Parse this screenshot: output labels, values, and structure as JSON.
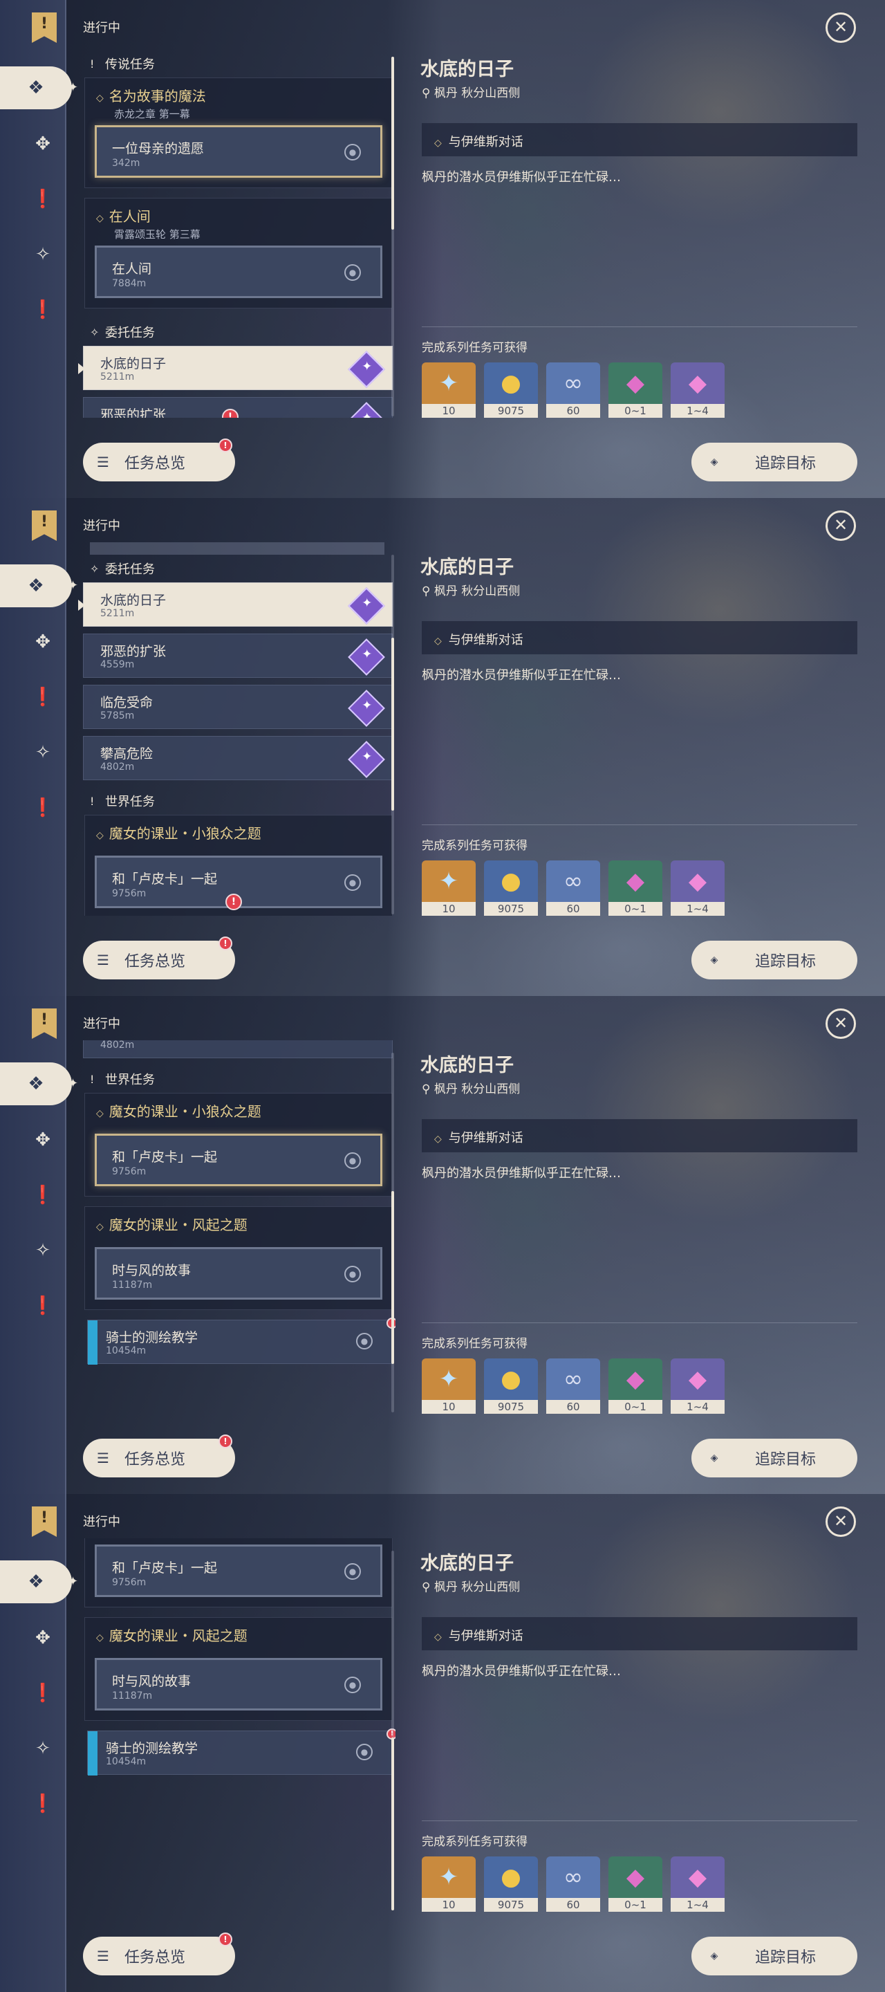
{
  "header": {
    "label": "进行中",
    "close": "✕"
  },
  "rail": {
    "bookmark": "!",
    "icons": [
      "quest-icon",
      "archon-icon",
      "alert-icon",
      "compass-icon",
      "alert-icon"
    ]
  },
  "categories": {
    "legend": "传说任务",
    "commission": "委托任务",
    "world": "世界任务"
  },
  "legend_chain_1": {
    "title": "名为故事的魔法",
    "sub": "赤龙之章 第一幕",
    "quest": "一位母亲的遗愿",
    "dist": "342m"
  },
  "legend_chain_2": {
    "title": "在人间",
    "sub": "霄露颂玉轮 第三幕",
    "quest": "在人间",
    "dist": "7884m"
  },
  "commissions": [
    {
      "title": "水底的日子",
      "dist": "5211m"
    },
    {
      "title": "邪恶的扩张",
      "dist": "4559m"
    },
    {
      "title": "临危受命",
      "dist": "5785m"
    },
    {
      "title": "攀高危险",
      "dist": "4802m"
    }
  ],
  "world_chain_1": {
    "title": "魔女的课业・小狼众之题",
    "quest": "和「卢皮卡」一起",
    "dist": "9756m"
  },
  "world_chain_2": {
    "title": "魔女的课业・风起之题",
    "quest": "时与风的故事",
    "dist": "11187m"
  },
  "daily": {
    "title": "骑士的测绘教学",
    "dist": "10454m"
  },
  "detail": {
    "name": "水底的日子",
    "location": "枫丹 秋分山西侧",
    "objective": "与伊维斯对话",
    "description": "枫丹的潜水员伊维斯似乎正在忙碌…",
    "reward_label": "完成系列任务可获得",
    "rewards": [
      {
        "icon": "primogem-icon",
        "count": "10",
        "color": "#c98a3e",
        "glyph": "✦"
      },
      {
        "icon": "mora-icon",
        "count": "9075",
        "color": "#4a6aa3",
        "glyph": "●"
      },
      {
        "icon": "exp-icon",
        "count": "60",
        "color": "#5b78b0",
        "glyph": "∞"
      },
      {
        "icon": "crystal-icon",
        "count": "0~1",
        "color": "#3f7a65",
        "glyph": "◆"
      },
      {
        "icon": "crystal-chunk-icon",
        "count": "1~4",
        "color": "#6a63a8",
        "glyph": "◆"
      }
    ]
  },
  "buttons": {
    "overview": "任务总览",
    "track": "追踪目标"
  }
}
